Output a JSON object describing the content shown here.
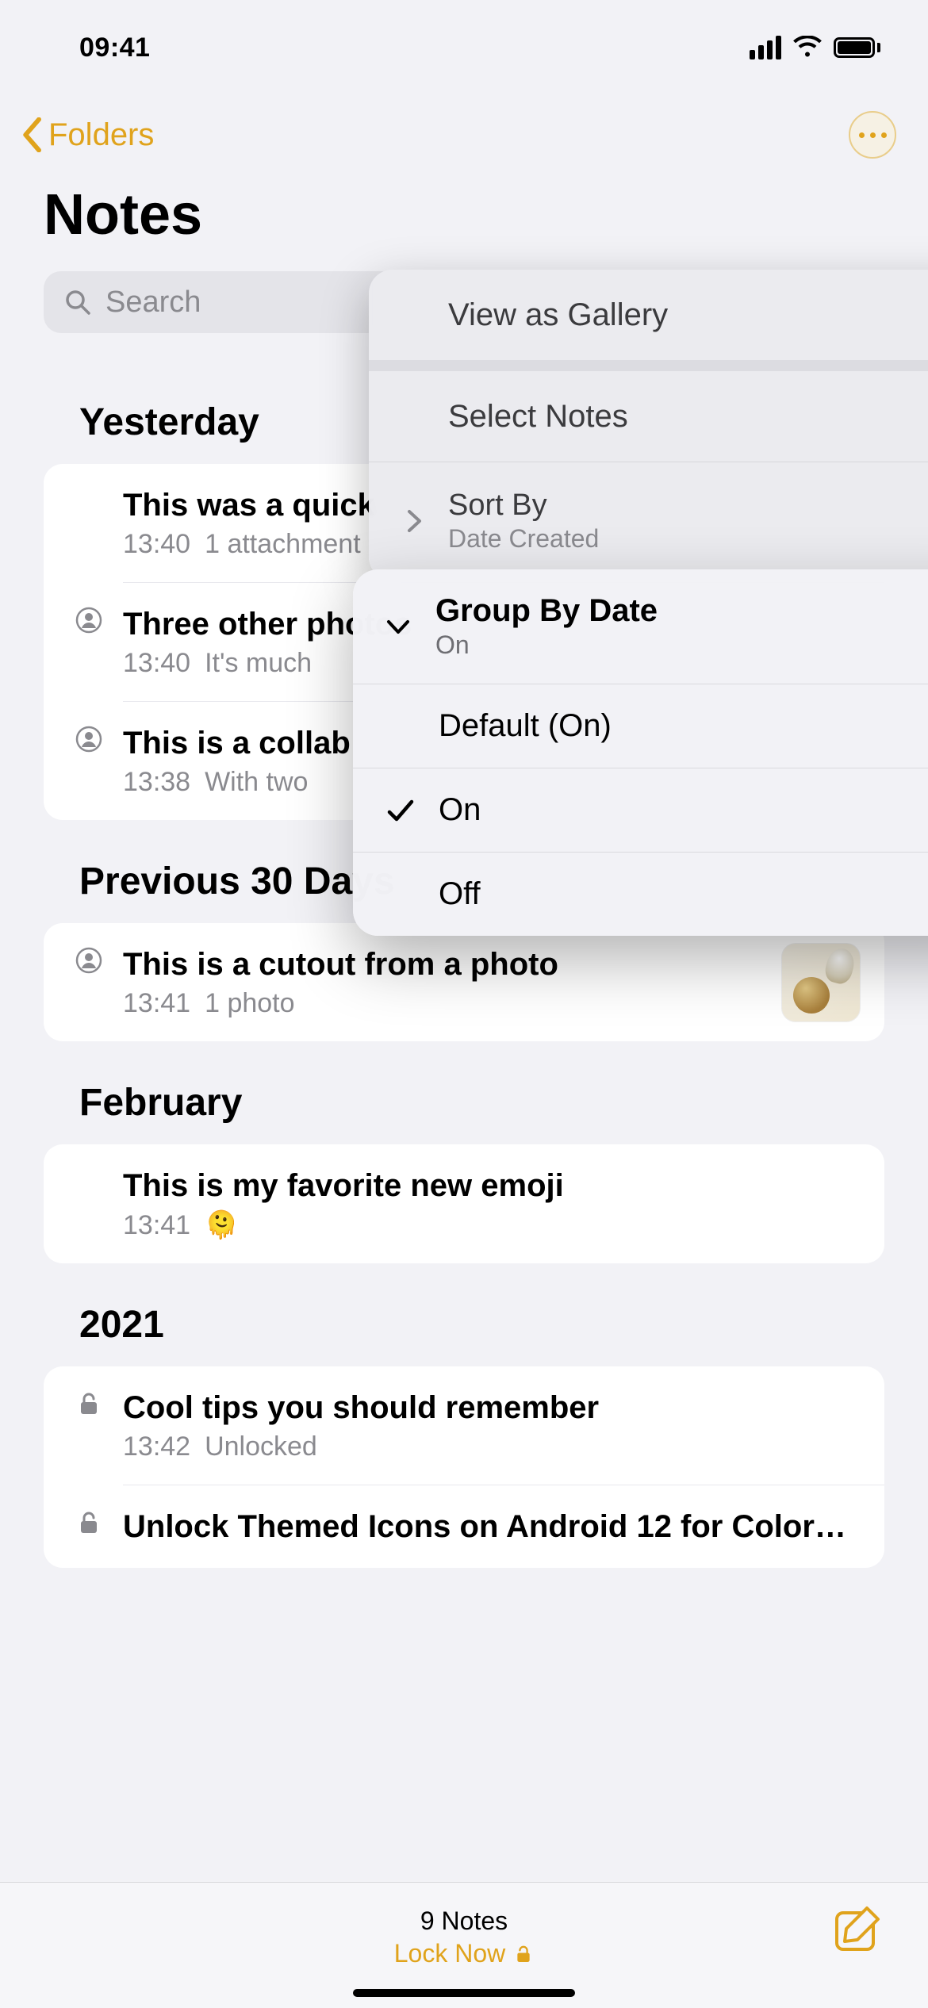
{
  "status": {
    "time": "09:41"
  },
  "nav": {
    "back_label": "Folders"
  },
  "title": "Notes",
  "search": {
    "placeholder": "Search"
  },
  "sections": [
    {
      "header": "Yesterday",
      "rows": [
        {
          "title": "This was a quick",
          "time": "13:40",
          "sub": "1 attachment",
          "shared": false
        },
        {
          "title": "Three other photos",
          "time": "13:40",
          "sub": "It's much",
          "shared": true
        },
        {
          "title": "This is a collab",
          "time": "13:38",
          "sub": "With two",
          "shared": true
        }
      ]
    },
    {
      "header": "Previous 30 Days",
      "rows": [
        {
          "title": "This is a cutout from a photo",
          "time": "13:41",
          "sub": "1 photo",
          "shared": true,
          "thumb": true
        }
      ]
    },
    {
      "header": "February",
      "rows": [
        {
          "title": "This is my favorite new emoji",
          "time": "13:41",
          "emoji": "🫠"
        }
      ]
    },
    {
      "header": "2021",
      "rows": [
        {
          "title": "Cool tips you should remember",
          "time": "13:42",
          "sub": "Unlocked",
          "lock": true
        },
        {
          "title": "Unlock Themed Icons on Android 12 for Color…",
          "lock": true
        }
      ]
    }
  ],
  "menu1": {
    "view_gallery": "View as Gallery",
    "select_notes": "Select Notes",
    "sort_by": "Sort By",
    "sort_by_value": "Date Created"
  },
  "menu2": {
    "header_title": "Group By Date",
    "header_value": "On",
    "opt_default": "Default (On)",
    "opt_on": "On",
    "opt_off": "Off"
  },
  "bottom": {
    "count": "9 Notes",
    "lock_now": "Lock Now"
  }
}
